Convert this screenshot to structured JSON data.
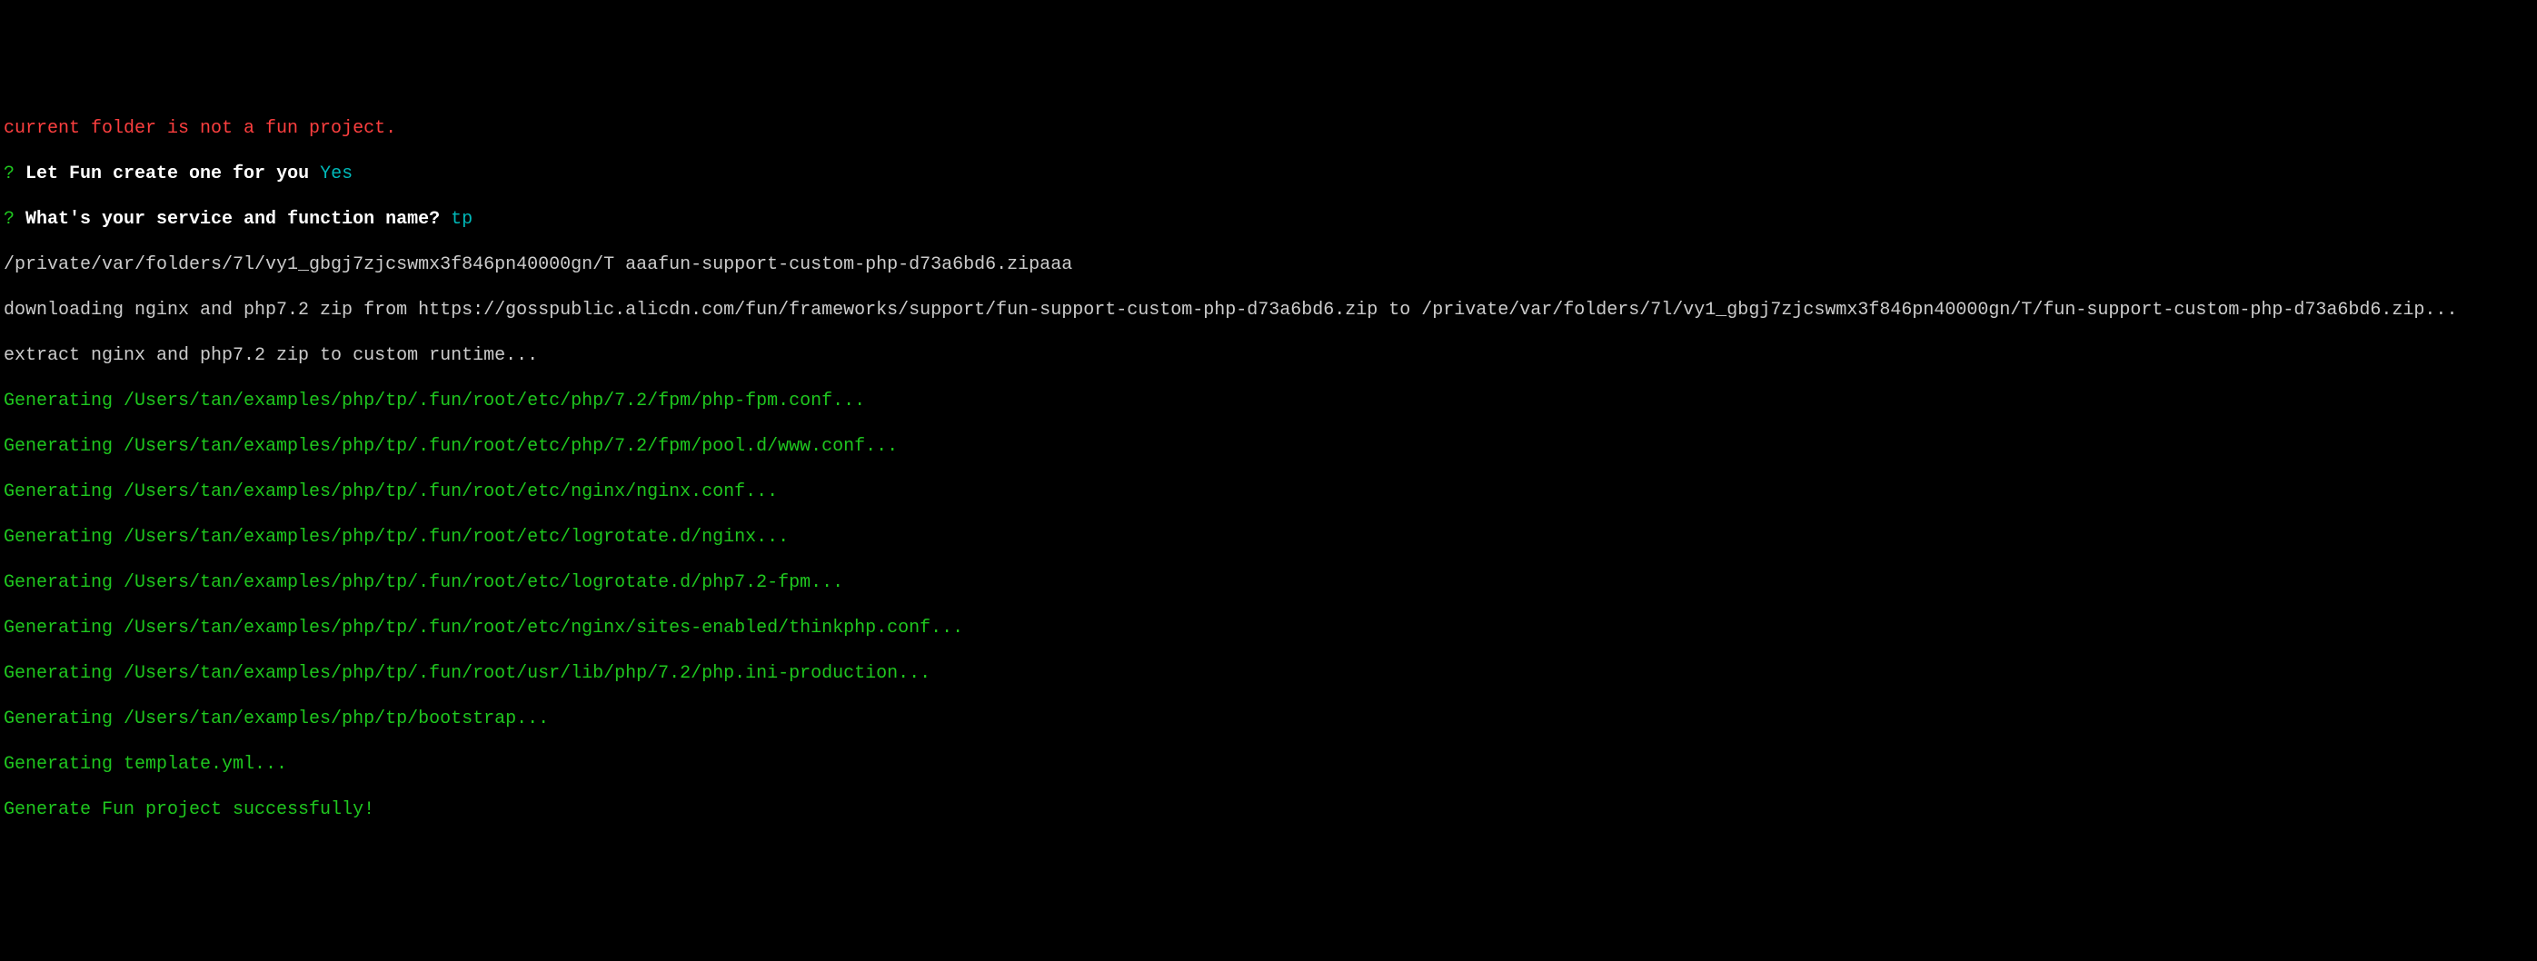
{
  "lines": {
    "error": "current folder is not a fun project.",
    "prompt1_q": "?",
    "prompt1_text": " Let Fun create one for you ",
    "prompt1_answer": "Yes",
    "prompt2_q": "?",
    "prompt2_text": " What's your service and function name? ",
    "prompt2_answer": "tp",
    "path_line": "/private/var/folders/7l/vy1_gbgj7zjcswmx3f846pn40000gn/T aaafun-support-custom-php-d73a6bd6.zipaaa",
    "download_line": "downloading nginx and php7.2 zip from https://gosspublic.alicdn.com/fun/frameworks/support/fun-support-custom-php-d73a6bd6.zip to /private/var/folders/7l/vy1_gbgj7zjcswmx3f846pn40000gn/T/fun-support-custom-php-d73a6bd6.zip...",
    "extract_line": "extract nginx and php7.2 zip to custom runtime...",
    "gen1": "Generating /Users/tan/examples/php/tp/.fun/root/etc/php/7.2/fpm/php-fpm.conf...",
    "gen2": "Generating /Users/tan/examples/php/tp/.fun/root/etc/php/7.2/fpm/pool.d/www.conf...",
    "gen3": "Generating /Users/tan/examples/php/tp/.fun/root/etc/nginx/nginx.conf...",
    "gen4": "Generating /Users/tan/examples/php/tp/.fun/root/etc/logrotate.d/nginx...",
    "gen5": "Generating /Users/tan/examples/php/tp/.fun/root/etc/logrotate.d/php7.2-fpm...",
    "gen6": "Generating /Users/tan/examples/php/tp/.fun/root/etc/nginx/sites-enabled/thinkphp.conf...",
    "gen7": "Generating /Users/tan/examples/php/tp/.fun/root/usr/lib/php/7.2/php.ini-production...",
    "gen8": "Generating /Users/tan/examples/php/tp/bootstrap...",
    "gen9": "Generating template.yml...",
    "success": "Generate Fun project successfully!"
  }
}
